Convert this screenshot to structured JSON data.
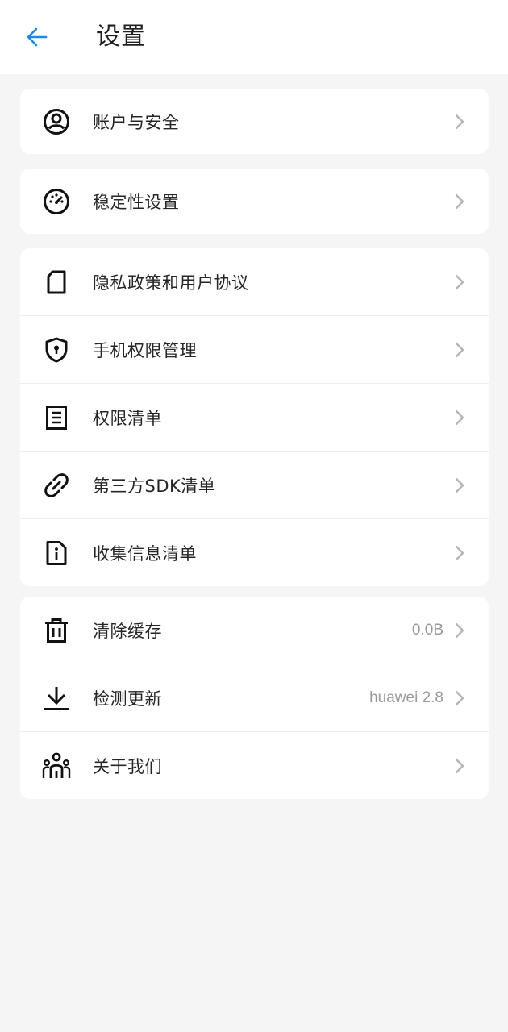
{
  "header": {
    "title": "设置"
  },
  "colors": {
    "accent": "#1e88e5",
    "background": "#f5f5f5",
    "card": "#ffffff",
    "text": "#262626",
    "secondary_text": "#9a9a9a",
    "chevron": "#b5b5b5"
  },
  "sections": [
    {
      "items": [
        {
          "icon": "account-circle-icon",
          "label": "账户与安全"
        }
      ]
    },
    {
      "items": [
        {
          "icon": "speedometer-icon",
          "label": "稳定性设置"
        }
      ]
    },
    {
      "items": [
        {
          "icon": "document-icon",
          "label": "隐私政策和用户协议"
        },
        {
          "icon": "shield-lock-icon",
          "label": "手机权限管理"
        },
        {
          "icon": "list-document-icon",
          "label": "权限清单"
        },
        {
          "icon": "link-icon",
          "label": "第三方SDK清单"
        },
        {
          "icon": "info-file-icon",
          "label": "收集信息清单"
        }
      ]
    },
    {
      "items": [
        {
          "icon": "trash-icon",
          "label": "清除缓存",
          "value": "0.0B"
        },
        {
          "icon": "download-icon",
          "label": "检测更新",
          "value": "huawei 2.8"
        },
        {
          "icon": "team-icon",
          "label": "关于我们"
        }
      ]
    }
  ]
}
